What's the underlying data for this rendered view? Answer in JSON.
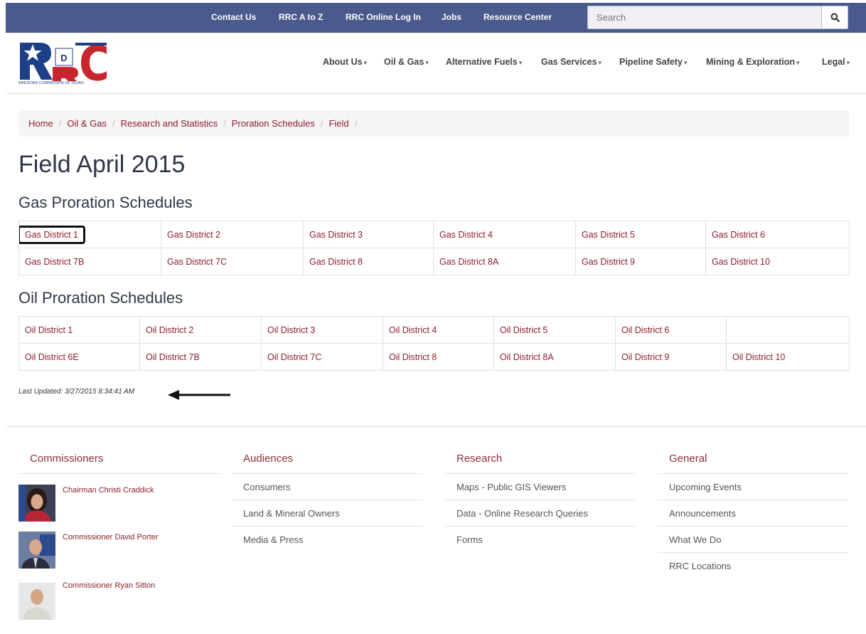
{
  "topbar": {
    "links": [
      "Contact Us",
      "RRC A to Z",
      "RRC Online Log In",
      "Jobs",
      "Resource Center"
    ],
    "search_placeholder": "Search",
    "colors": {
      "bar": "#4b5a8c"
    }
  },
  "logo": {
    "letters": "RRC",
    "small_letter": "D",
    "caption": "RAILROAD COMMISSION OF TEXAS"
  },
  "nav": {
    "items": [
      "About Us",
      "Oil & Gas",
      "Alternative Fuels",
      "Gas Services",
      "Pipeline Safety",
      "Mining & Exploration",
      "Legal"
    ],
    "caret": "▾"
  },
  "breadcrumb": [
    "Home",
    "Oil & Gas",
    "Research and Statistics",
    "Proration Schedules",
    "Field"
  ],
  "breadcrumb_sep": "/",
  "page_title": "Field April 2015",
  "gas": {
    "title": "Gas Proration Schedules",
    "rows": [
      [
        "Gas District 1",
        "Gas District 2",
        "Gas District 3",
        "Gas District 4",
        "Gas District 5",
        "Gas District 6"
      ],
      [
        "Gas District 7B",
        "Gas District 7C",
        "Gas District 8",
        "Gas District 8A",
        "Gas District 9",
        "Gas District 10"
      ]
    ]
  },
  "oil": {
    "title": "Oil Proration Schedules",
    "rows": [
      [
        "Oil District 1",
        "Oil District 2",
        "Oil District 3",
        "Oil District 4",
        "Oil District 5",
        "Oil District 6",
        ""
      ],
      [
        "Oil District 6E",
        "Oil District 7B",
        "Oil District 7C",
        "Oil District 8",
        "Oil District 8A",
        "Oil District 9",
        "Oil District 10"
      ]
    ]
  },
  "last_updated": "Last Updated: 3/27/2015 8:34:41 AM",
  "footer": {
    "commissioners": {
      "title": "Commissioners",
      "people": [
        "Chairman Christi Craddick",
        "Commissioner David Porter",
        "Commissioner Ryan Sitton"
      ]
    },
    "audiences": {
      "title": "Audiences",
      "links": [
        "Consumers",
        "Land & Mineral Owners",
        "Media & Press"
      ]
    },
    "research": {
      "title": "Research",
      "links": [
        "Maps - Public GIS Viewers",
        "Data - Online Research Queries",
        "Forms"
      ]
    },
    "general": {
      "title": "General",
      "links": [
        "Upcoming Events",
        "Announcements",
        "What We Do",
        "RRC Locations"
      ]
    }
  },
  "accent_color": "#8d1d2c"
}
